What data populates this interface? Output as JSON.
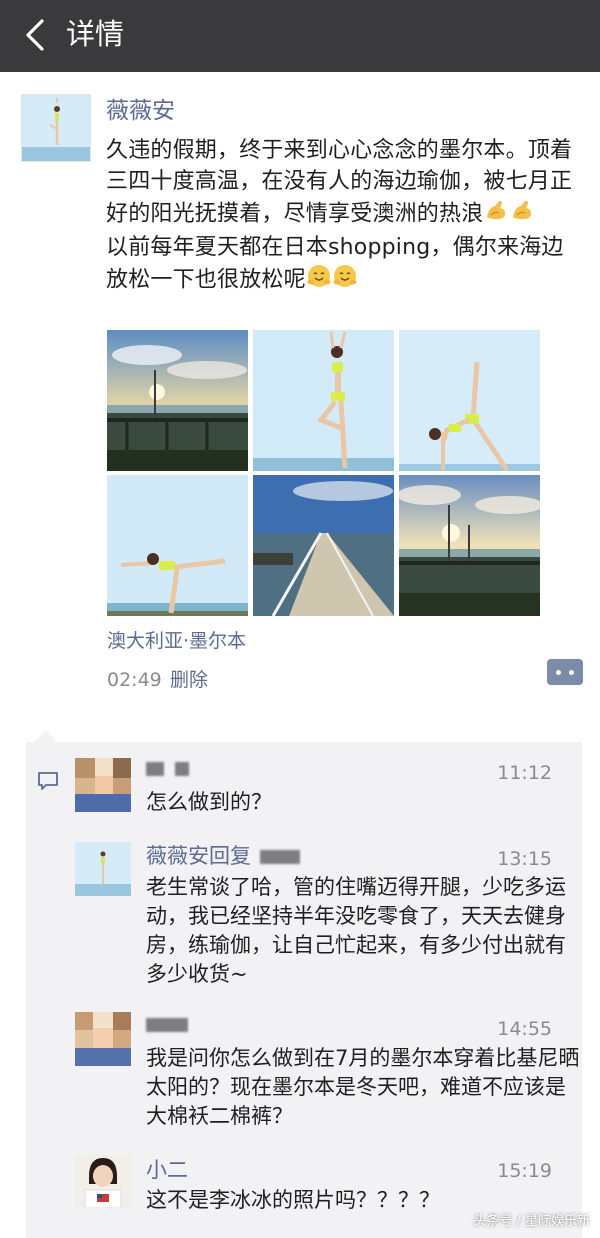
{
  "topbar": {
    "title": "详情",
    "back_icon": "chevron-left-icon"
  },
  "post": {
    "author": "薇薇安",
    "text_line1": "久违的假期，终于来到心心念念的墨尔本。顶着三四十度高温，在没有人的海边瑜伽，被七月正好的阳光抚摸着，尽情享受澳洲的热浪",
    "text_line2": "以前每年夏天都在日本shopping，偶尔来海边放松一下也很放松呢",
    "location": "澳大利亚·墨尔本",
    "time": "02:49",
    "delete_label": "删除"
  },
  "comments": [
    {
      "name": "",
      "time": "11:12",
      "text": "怎么做到的？"
    },
    {
      "name": "薇薇安回复",
      "time": "13:15",
      "text": "老生常谈了哈，管的住嘴迈得开腿，少吃多运动，我已经坚持半年没吃零食了，天天去健身房，练瑜伽，让自己忙起来，有多少付出就有多少收货~"
    },
    {
      "name": "",
      "time": "14:55",
      "text": "我是问你怎么做到在7月的墨尔本穿着比基尼晒太阳的？现在墨尔本是冬天吧，难道不应该是大棉袄二棉裤？"
    },
    {
      "name": "小二",
      "time": "15:19",
      "text": "这不是李冰冰的照片吗？？？？"
    }
  ],
  "watermark": "头条号 / 星际娱乐新",
  "colors": {
    "topbar": "#3a3a3c",
    "link": "#5b6b92",
    "panel": "#f2f2f4",
    "muted": "#8b8b8b"
  }
}
